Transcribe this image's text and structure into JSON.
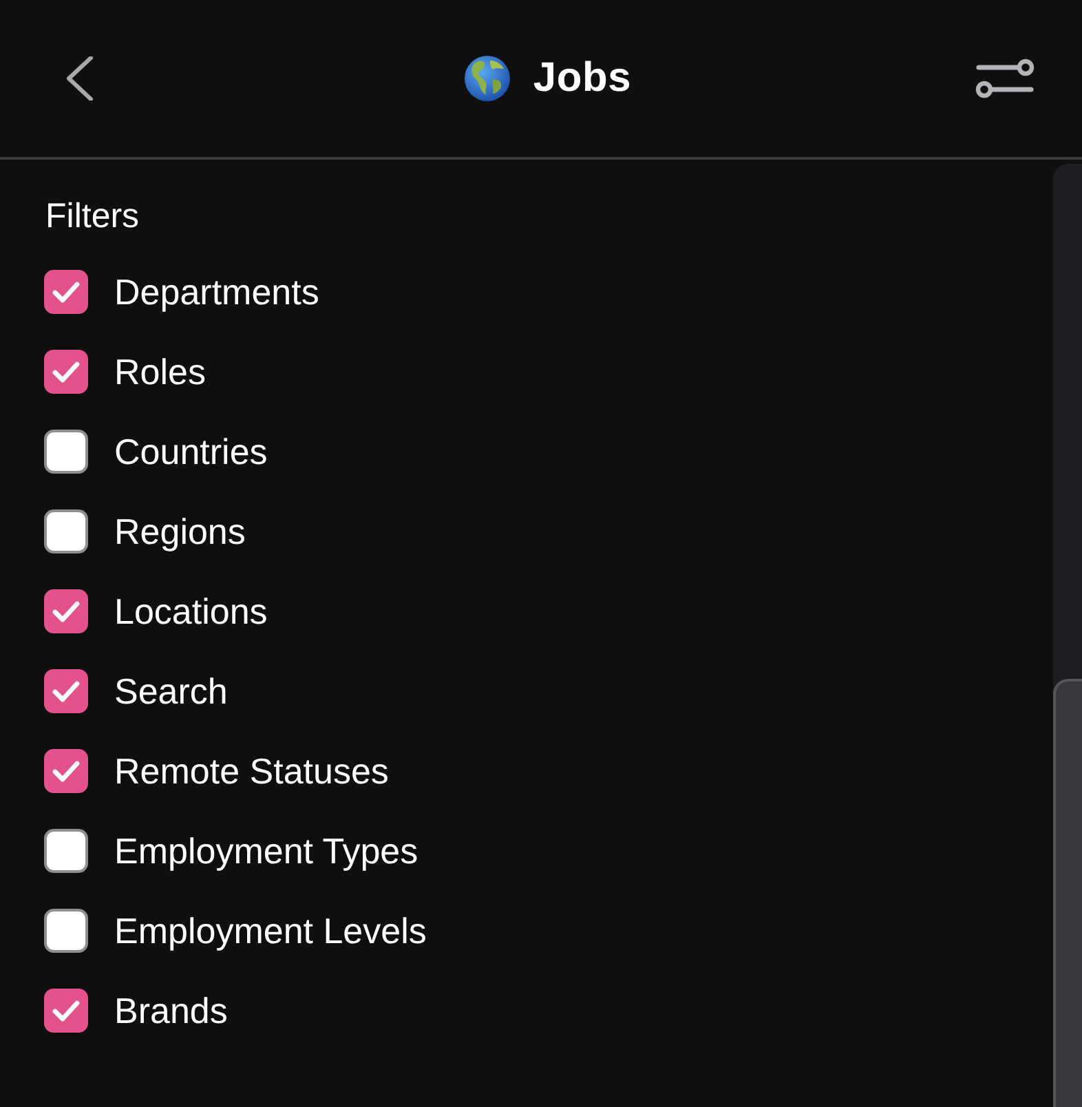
{
  "header": {
    "title": "Jobs"
  },
  "filters": {
    "heading": "Filters",
    "items": [
      {
        "label": "Departments",
        "checked": true
      },
      {
        "label": "Roles",
        "checked": true
      },
      {
        "label": "Countries",
        "checked": false
      },
      {
        "label": "Regions",
        "checked": false
      },
      {
        "label": "Locations",
        "checked": true
      },
      {
        "label": "Search",
        "checked": true
      },
      {
        "label": "Remote Statuses",
        "checked": true
      },
      {
        "label": "Employment Types",
        "checked": false
      },
      {
        "label": "Employment Levels",
        "checked": false
      },
      {
        "label": "Brands",
        "checked": true
      }
    ]
  }
}
